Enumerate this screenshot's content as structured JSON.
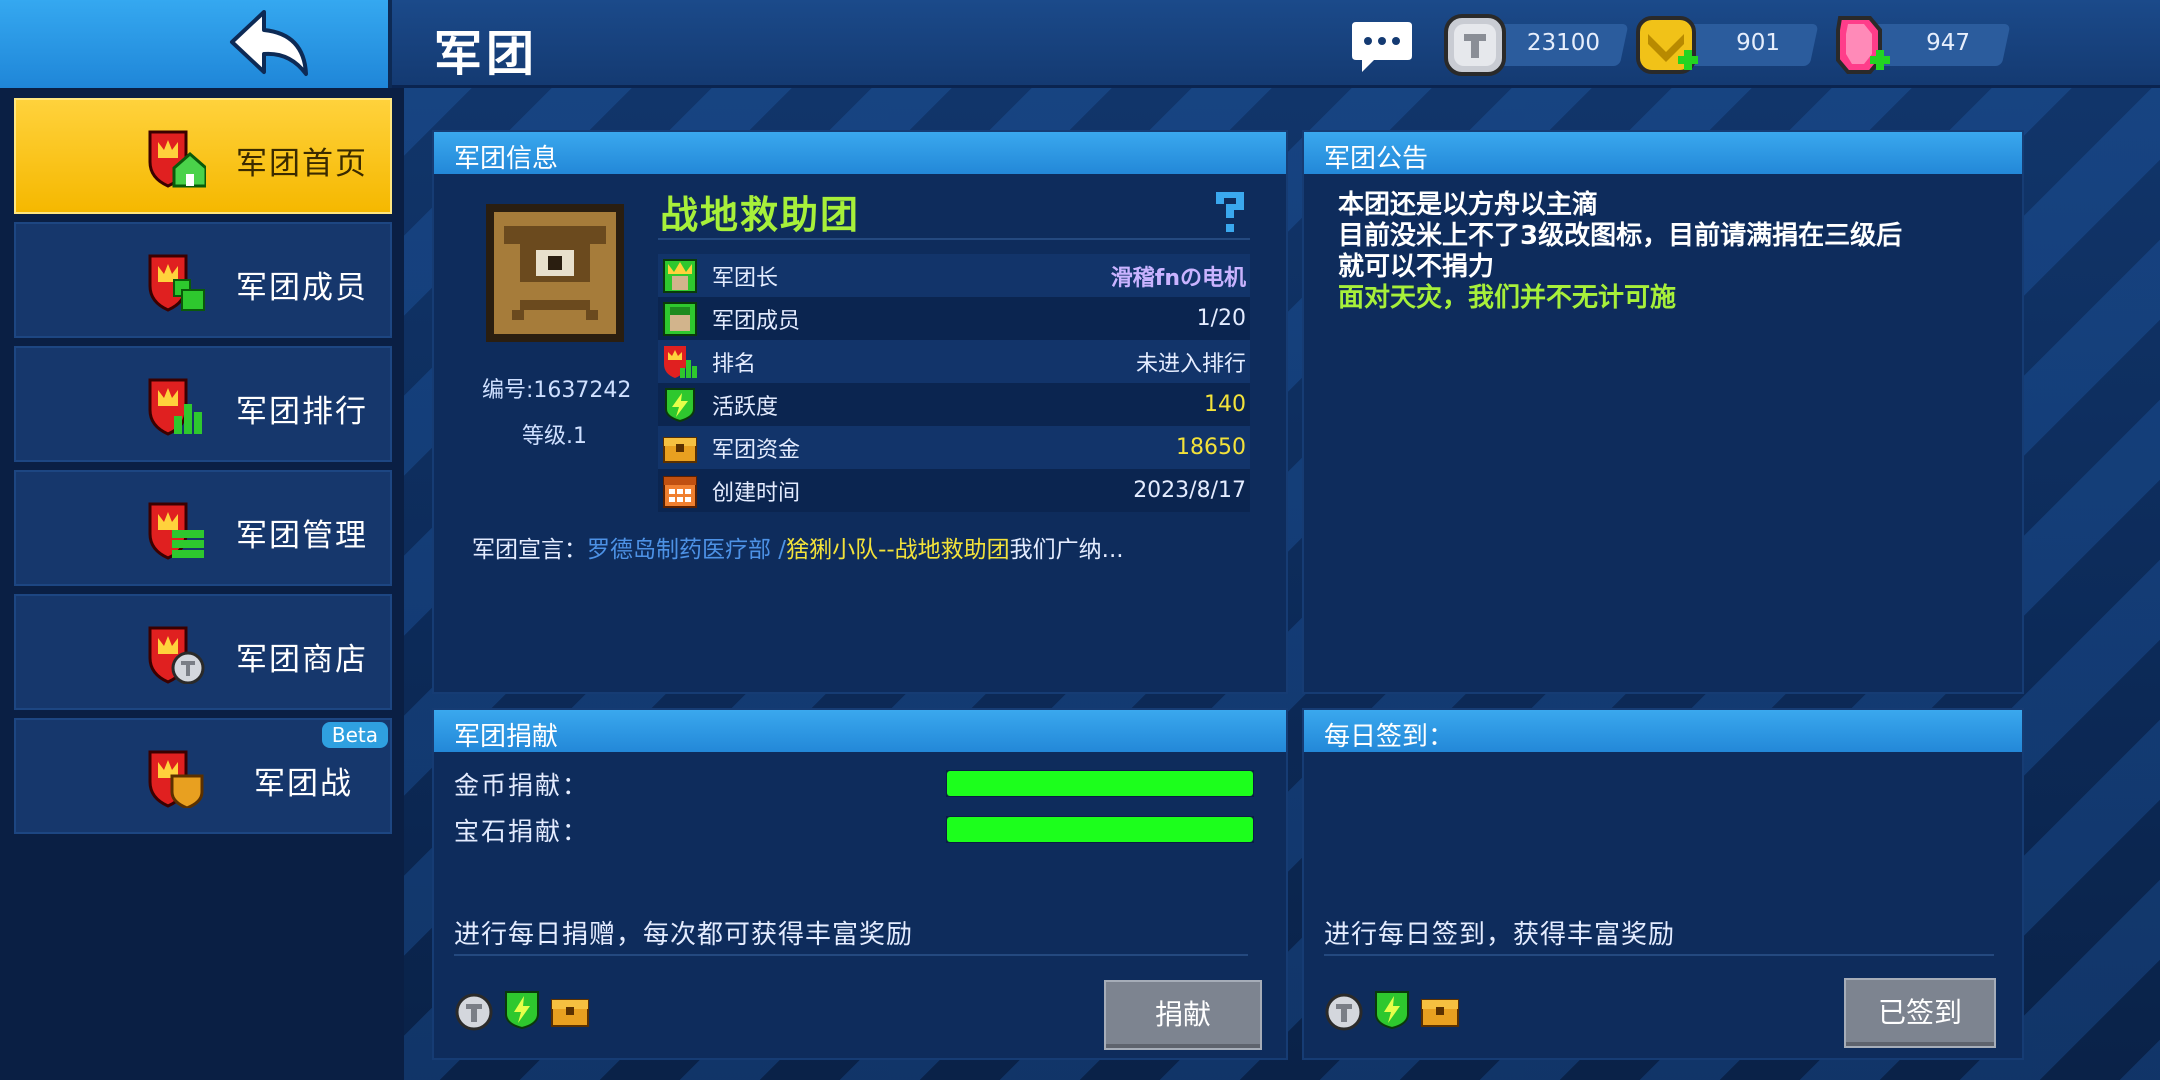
{
  "header": {
    "title": "军团",
    "currencies": [
      {
        "icon": "silver-coin-icon",
        "value": "23100"
      },
      {
        "icon": "gold-chevron-icon",
        "value": "901"
      },
      {
        "icon": "pink-gem-icon",
        "value": "947"
      }
    ]
  },
  "sidebar": {
    "items": [
      {
        "label": "军团首页",
        "icon": "clan-home-icon",
        "active": true
      },
      {
        "label": "军团成员",
        "icon": "clan-members-icon"
      },
      {
        "label": "军团排行",
        "icon": "clan-ranking-icon"
      },
      {
        "label": "军团管理",
        "icon": "clan-manage-icon"
      },
      {
        "label": "军团商店",
        "icon": "clan-shop-icon"
      },
      {
        "label": "军团战",
        "icon": "clan-war-icon",
        "badge": "Beta"
      }
    ]
  },
  "info": {
    "title": "军团信息",
    "name": "战地救助团",
    "id_text": "编号:1637242",
    "level_text": "等级.1",
    "rows": [
      {
        "icon": "leader-icon",
        "label": "军团长",
        "value": "滑稽fnの电机"
      },
      {
        "icon": "member-icon",
        "label": "军团成员",
        "value": "1/20"
      },
      {
        "icon": "rank-icon",
        "label": "排名",
        "value": "未进入排行"
      },
      {
        "icon": "activity-icon",
        "label": "活跃度",
        "value": "140"
      },
      {
        "icon": "treasury-icon",
        "label": "军团资金",
        "value": "18650"
      },
      {
        "icon": "calendar-icon",
        "label": "创建时间",
        "value": "2023/8/17"
      }
    ],
    "declaration_label": "军团宣言：",
    "declaration_part1": "罗德岛制药医疗部 /",
    "declaration_part2": "猞猁小队--战地救助团",
    "declaration_part3": "我们广纳..."
  },
  "notice": {
    "title": "军团公告",
    "lines": [
      "本团还是以方舟以主滴",
      "目前没米上不了3级改图标，目前请满捐在三级后",
      "就可以不捐力"
    ],
    "highlight": "面对天灾，我们并不无计可施"
  },
  "donate": {
    "title": "军团捐献",
    "coin_label": "金币捐献：",
    "gem_label": "宝石捐献：",
    "coin_progress": 1.0,
    "gem_progress": 1.0,
    "hint": "进行每日捐赠，每次都可获得丰富奖励",
    "button": "捐献"
  },
  "checkin": {
    "title": "每日签到：",
    "hint": "进行每日签到，获得丰富奖励",
    "button": "已签到"
  },
  "colors": {
    "accent": "#2388d8",
    "active_tab": "#f5b800",
    "progress": "#1cff1c",
    "clan_name": "#a7f03a"
  }
}
